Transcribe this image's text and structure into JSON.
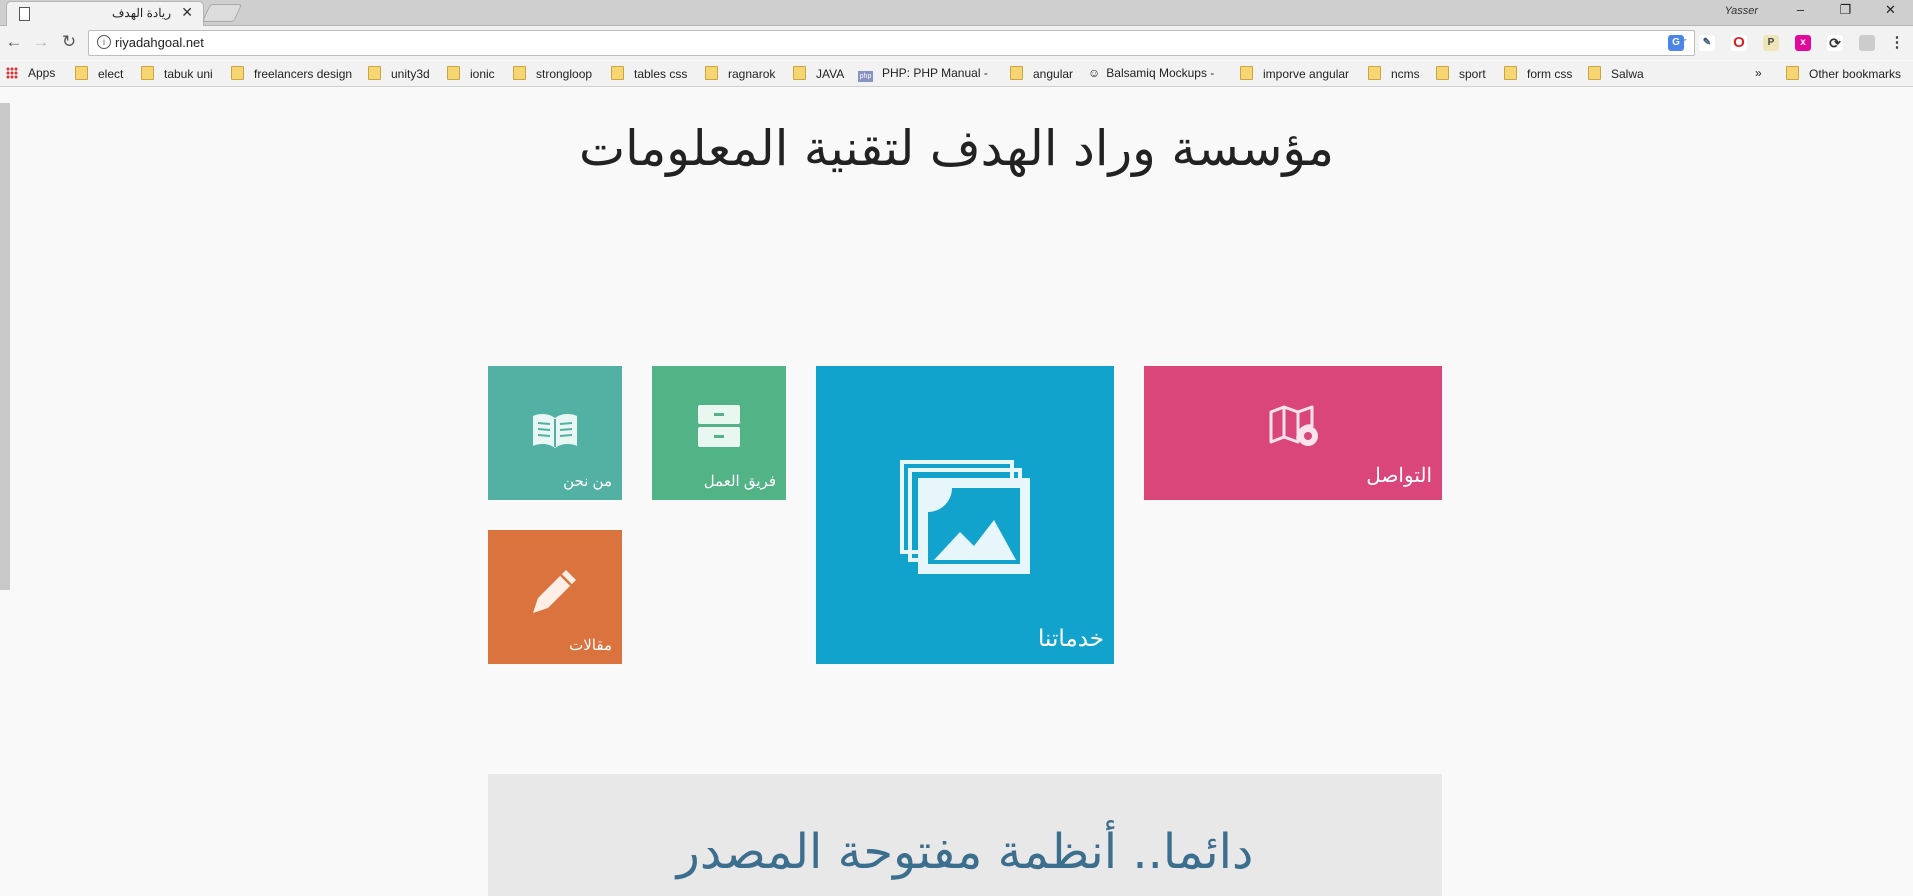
{
  "browser": {
    "tab_title": "ريادة الهدف",
    "user_name": "Yasser",
    "url": "riyadahgoal.net",
    "bookmarks": [
      "Apps",
      "elect",
      "tabuk uni",
      "freelancers design",
      "unity3d",
      "ionic",
      "strongloop",
      "tables css",
      "ragnarok",
      "JAVA",
      "PHP: PHP Manual - M",
      "angular",
      "Balsamiq Mockups -",
      "imporve angular",
      "ncms",
      "sport",
      "form css",
      "Salwa"
    ],
    "more_bookmarks": "»",
    "other_bookmarks": "Other bookmarks"
  },
  "page": {
    "heading": "مؤسسة وراد الهدف لتقنية المعلومات",
    "tiles": {
      "about": "من نحن",
      "team": "فريق العمل",
      "services": "خدماتنا",
      "contact": "التواصل",
      "articles": "مقالات"
    },
    "banner_text": "دائما.. أنظمة مفتوحة المصدر"
  },
  "colors": {
    "about": "#52b1a2",
    "team": "#52b386",
    "services": "#12a3cc",
    "contact": "#da4679",
    "articles": "#da733e",
    "banner_text": "#3c6e8e"
  }
}
